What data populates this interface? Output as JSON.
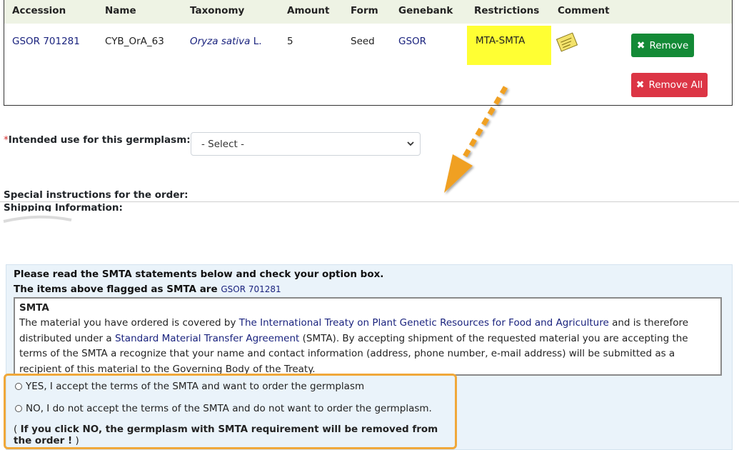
{
  "order_table": {
    "headers": [
      "Accession",
      "Name",
      "Taxonomy",
      "Amount",
      "Form",
      "Genebank",
      "Restrictions",
      "Comment"
    ],
    "row": {
      "accession": "GSOR 701281",
      "name": "CYB_OrA_63",
      "taxonomy_genus_species": "Oryza sativa",
      "taxonomy_author": "L.",
      "amount": "5",
      "form": "Seed",
      "genebank": "GSOR",
      "restrictions": "MTA-SMTA",
      "comment_icon": "note-icon"
    },
    "remove_label": "Remove",
    "remove_all_label": "Remove All"
  },
  "intended_use": {
    "required_mark": "*",
    "label": "Intended use for this germplasm:",
    "select_value": "- Select -"
  },
  "special_instructions_label": "Special instructions for the order:",
  "shipping_label": "Shipping Information:",
  "smta": {
    "intro": "Please read the SMTA statements below and check your option box.",
    "flagged_prefix": "The items above flagged as SMTA are",
    "flagged_accession": "GSOR 701281",
    "box_title": "SMTA",
    "text_1": "The material you have ordered is covered by",
    "treaty_link": "The International Treaty on Plant Genetic Resources for Food and Agriculture",
    "text_2": "and is therefore distributed under a",
    "smta_link": "Standard Material Transfer Agreement",
    "text_3": "(SMTA). By accepting shipment of the requested material you are accepting the terms of the SMTA a recognize that your name and contact information (address, phone number, e-mail address) will be submitted as a recipient of this material to the Governing Body of the Treaty.",
    "option_yes": "YES, I accept the terms of the SMTA and want to order the germplasm",
    "option_no": "NO, I do not accept the terms of the SMTA and do not want to order the germplasm.",
    "warning_open": "(",
    "warning_bold": "If you click NO, the germplasm with SMTA requirement will be removed from the order !",
    "warning_close": ")"
  },
  "colors": {
    "link": "#1a237e",
    "restriction_highlight": "#ffff33",
    "remove_button": "#138a36",
    "remove_all_button": "#dc3545",
    "callout": "#f0a83a",
    "panel_bg": "#eaf3fa"
  }
}
